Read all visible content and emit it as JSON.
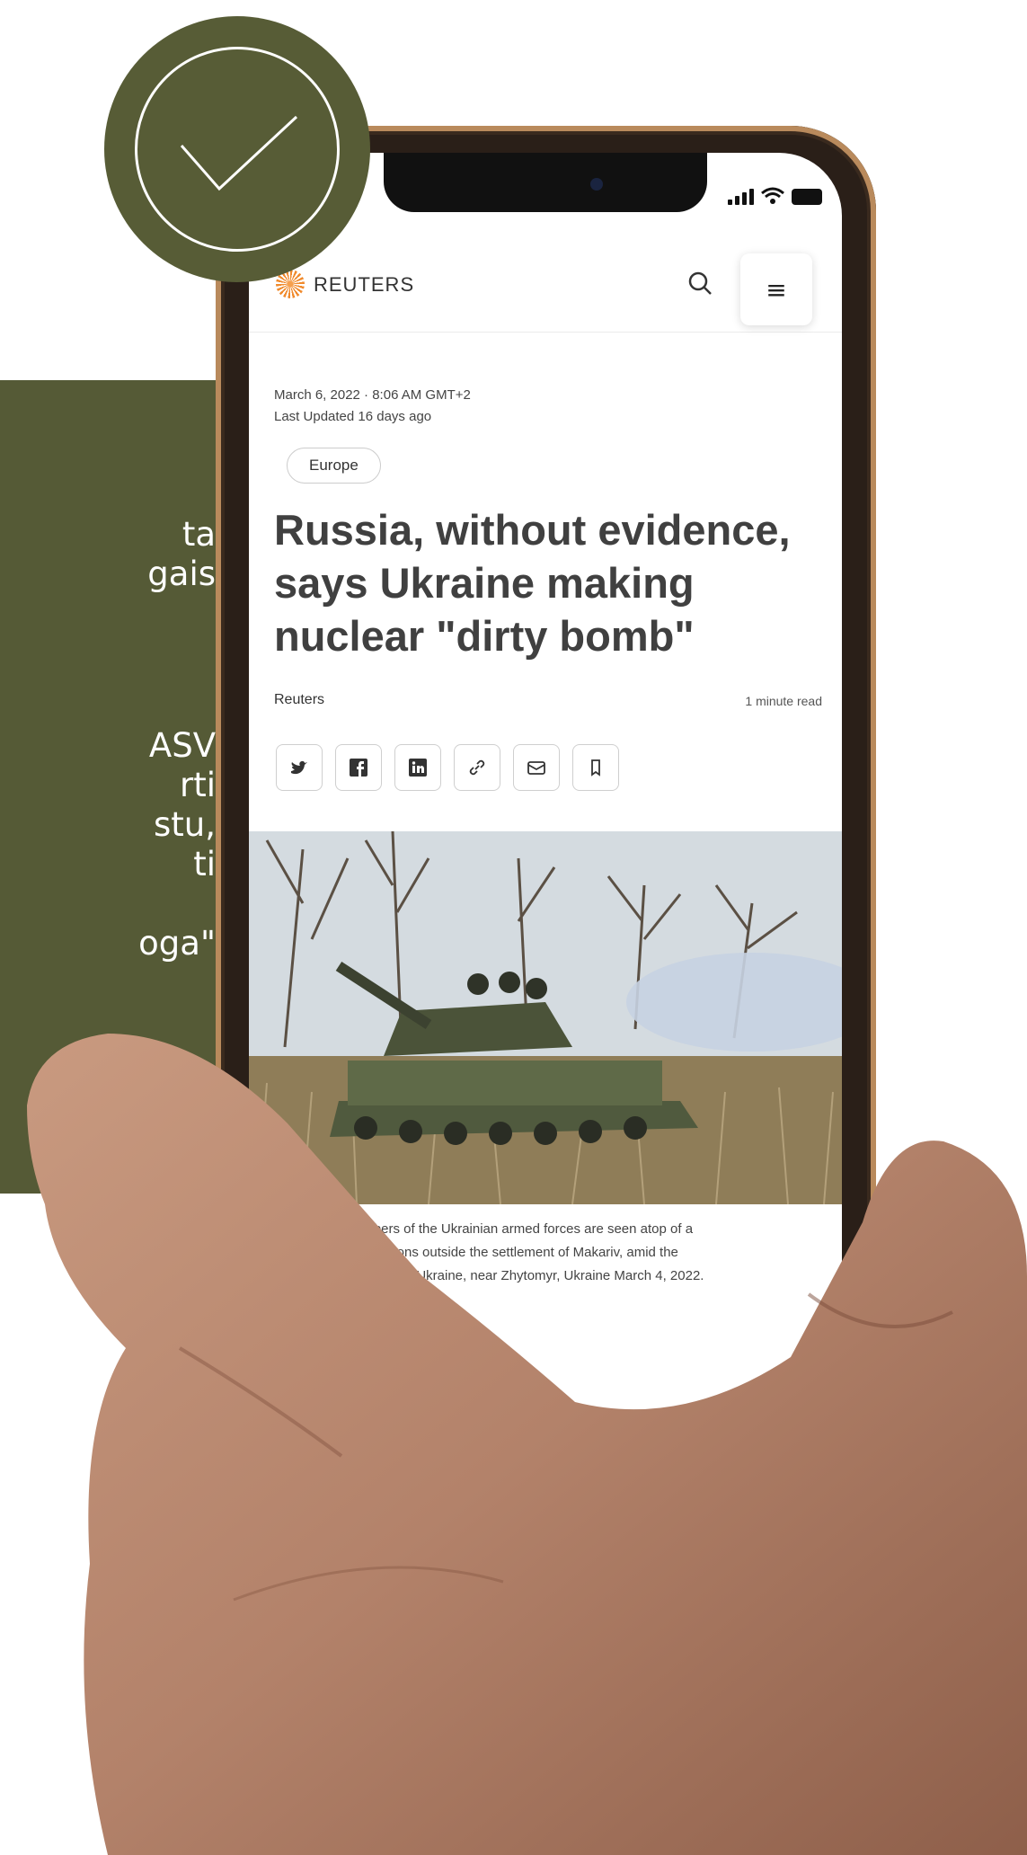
{
  "side_panel": {
    "line_1": "ta",
    "line_2": "gais",
    "line_3": "ASV",
    "line_4": "rti",
    "line_5": "stu,",
    "line_6": "ti",
    "line_7": "oga\""
  },
  "status_bar": {
    "icons": [
      "signal-icon",
      "wifi-icon",
      "battery-icon"
    ]
  },
  "header": {
    "brand": "REUTERS",
    "icons": [
      "search-icon",
      "menu-icon"
    ],
    "menu_glyph": "≡"
  },
  "article": {
    "date": "March 6, 2022 · 8:06 AM GMT+2",
    "updated": "Last Updated 16 days ago",
    "tag": "Europe",
    "headline": "Russia, without evidence, says Ukraine making nuclear \"dirty bomb\"",
    "byline": "Reuters",
    "read_time": "1 minute read",
    "share_icons": [
      "twitter-icon",
      "facebook-icon",
      "linkedin-icon",
      "link-icon",
      "email-icon",
      "bookmark-icon"
    ],
    "caption_line_1": "embers of the Ukrainian armed forces are seen atop of a",
    "caption_line_2": "ositions outside the settlement of Makariv, amid the",
    "caption_line_3": "f Ukraine, near Zhytomyr, Ukraine March 4, 2022."
  },
  "colors": {
    "olive": "#555a36",
    "brand_orange": "#f08a2c"
  }
}
